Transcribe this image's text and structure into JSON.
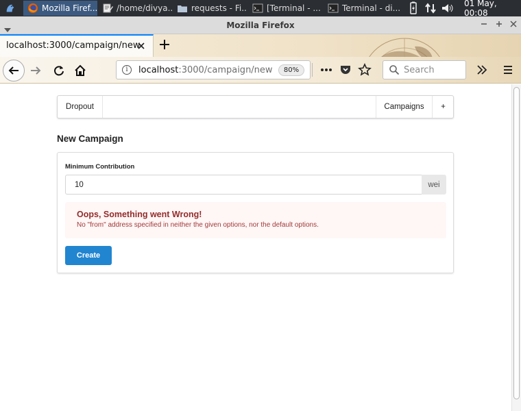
{
  "taskbar": {
    "apps": [
      {
        "label": "Mozilla Firef...",
        "icon": "firefox-icon",
        "active": true
      },
      {
        "label": "/home/divya...",
        "icon": "text-editor-icon",
        "active": false
      },
      {
        "label": "requests - Fi...",
        "icon": "folder-icon",
        "active": false
      },
      {
        "label": "[Terminal - ...",
        "icon": "terminal-icon",
        "active": false
      },
      {
        "label": "Terminal - di...",
        "icon": "terminal-icon",
        "active": false
      }
    ],
    "clock": "01 May, 00:08"
  },
  "window": {
    "title": "Mozilla Firefox"
  },
  "browser": {
    "tab_title": "localhost:3000/campaign/new",
    "url_host": "localhost",
    "url_rest": ":3000/campaign/new",
    "zoom": "80%",
    "search_placeholder": "Search"
  },
  "app": {
    "brand": "Dropout",
    "menu_right": [
      {
        "label": "Campaigns"
      },
      {
        "label": "+"
      }
    ],
    "page_title": "New Campaign",
    "form": {
      "field_label": "Minimum Contribution",
      "field_value": "10",
      "unit": "wei",
      "submit_label": "Create"
    },
    "error": {
      "title": "Oops, Something went Wrong!",
      "message": "No \"from\" address specified in neither the given options, nor the default options."
    }
  },
  "colors": {
    "accent_blue": "#2185d0",
    "error_text": "#9f3a38",
    "error_bg": "#fff6f6"
  }
}
